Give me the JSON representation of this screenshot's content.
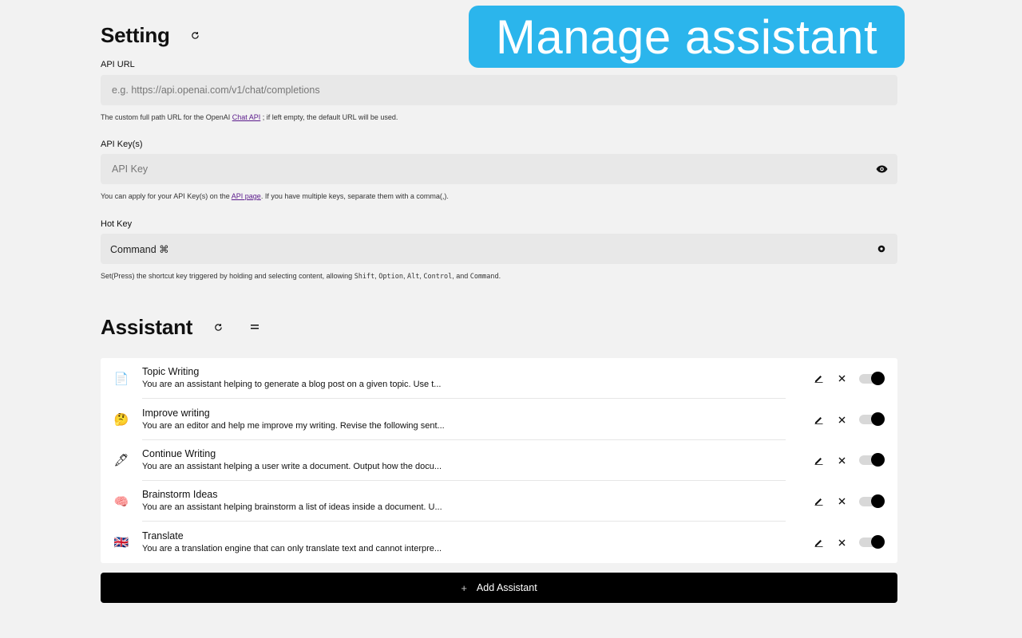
{
  "banner": {
    "text": "Manage assistant",
    "color": "#2bb5ec"
  },
  "setting": {
    "title": "Setting",
    "api_url": {
      "label": "API URL",
      "placeholder": "e.g. https://api.openai.com/v1/chat/completions",
      "help_before": "The custom full path URL for the OpenAI ",
      "help_link": "Chat API",
      "help_after": " ; if left empty, the default URL will be used."
    },
    "api_key": {
      "label": "API Key(s)",
      "placeholder": "API Key",
      "help_before": "You can apply for your API Key(s) on the ",
      "help_link": "API page",
      "help_after": ". If you have multiple keys, separate them with a comma(,)."
    },
    "hot_key": {
      "label": "Hot Key",
      "value": "Command ⌘",
      "help_before": "Set(Press) the shortcut key triggered by holding and selecting content, allowing ",
      "keys": [
        "Shift",
        "Option",
        "Alt",
        "Control",
        "Command"
      ],
      "sep": ", ",
      "and": ", and ",
      "end": "."
    }
  },
  "assistant": {
    "title": "Assistant",
    "items": [
      {
        "emoji": "📄",
        "icon": "page-icon",
        "name": "Topic Writing",
        "prompt": "You are an assistant helping to generate a blog post on a given topic. Use t...",
        "enabled": true
      },
      {
        "emoji": "🤔",
        "icon": "thinking-face-icon",
        "name": "Improve writing",
        "prompt": "You are an editor and help me improve my writing. Revise the following sent...",
        "enabled": true
      },
      {
        "emoji": "🖋",
        "icon": "fountain-pen-icon",
        "name": "Continue Writing",
        "prompt": "You are an assistant helping a user write a document. Output how the docu...",
        "enabled": true
      },
      {
        "emoji": "🧠",
        "icon": "brain-icon",
        "name": "Brainstorm Ideas",
        "prompt": "You are an assistant helping brainstorm a list of ideas inside a document. U...",
        "enabled": true
      },
      {
        "emoji": "🇬🇧",
        "icon": "uk-flag-icon",
        "name": "Translate",
        "prompt": "You are a translation engine that can only translate text and cannot interpre...",
        "enabled": true
      }
    ],
    "add_label": "Add Assistant",
    "add_icon": "+"
  }
}
